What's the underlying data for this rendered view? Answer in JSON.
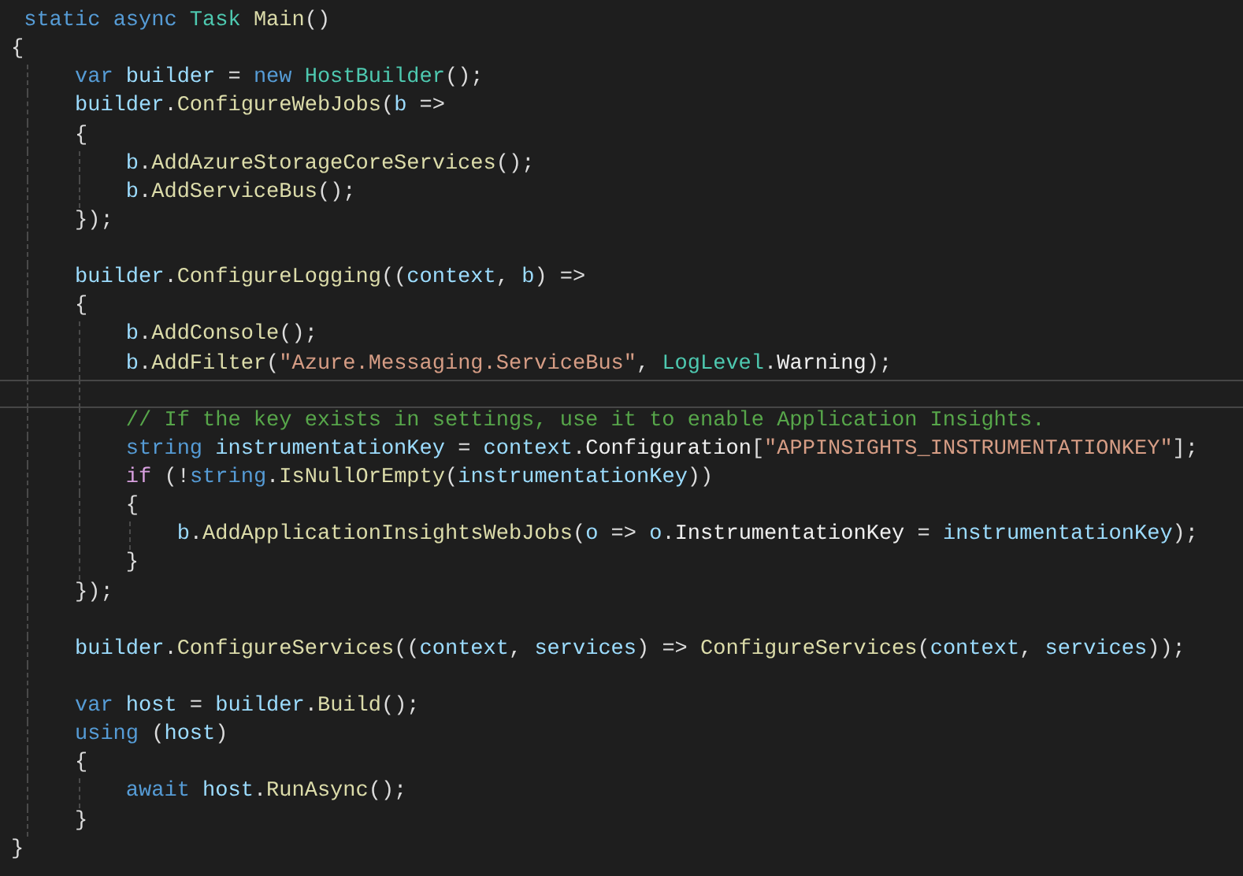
{
  "editor": {
    "lines": [
      {
        "kind": "code",
        "current": false,
        "tokens": [
          {
            "text": " static",
            "kind": "k"
          },
          {
            "text": " async",
            "kind": "k"
          },
          {
            "text": " Task",
            "kind": "y"
          },
          {
            "text": " Main",
            "kind": "m"
          },
          {
            "text": "()",
            "kind": "p"
          }
        ]
      },
      {
        "kind": "code",
        "current": false,
        "tokens": [
          {
            "text": "{",
            "kind": "p"
          }
        ]
      },
      {
        "kind": "code",
        "current": false,
        "tokens": [
          {
            "text": "     var",
            "kind": "k"
          },
          {
            "text": " builder",
            "kind": "v"
          },
          {
            "text": " = ",
            "kind": "p"
          },
          {
            "text": "new",
            "kind": "k"
          },
          {
            "text": " HostBuilder",
            "kind": "y"
          },
          {
            "text": "();",
            "kind": "p"
          }
        ]
      },
      {
        "kind": "code",
        "current": false,
        "tokens": [
          {
            "text": "     builder",
            "kind": "v"
          },
          {
            "text": ".",
            "kind": "p"
          },
          {
            "text": "ConfigureWebJobs",
            "kind": "m"
          },
          {
            "text": "(",
            "kind": "p"
          },
          {
            "text": "b",
            "kind": "v"
          },
          {
            "text": " =>",
            "kind": "p"
          }
        ]
      },
      {
        "kind": "code",
        "current": false,
        "tokens": [
          {
            "text": "     {",
            "kind": "p"
          }
        ]
      },
      {
        "kind": "code",
        "current": false,
        "tokens": [
          {
            "text": "         b",
            "kind": "v"
          },
          {
            "text": ".",
            "kind": "p"
          },
          {
            "text": "AddAzureStorageCoreServices",
            "kind": "m"
          },
          {
            "text": "();",
            "kind": "p"
          }
        ]
      },
      {
        "kind": "code",
        "current": false,
        "tokens": [
          {
            "text": "         b",
            "kind": "v"
          },
          {
            "text": ".",
            "kind": "p"
          },
          {
            "text": "AddServiceBus",
            "kind": "m"
          },
          {
            "text": "();",
            "kind": "p"
          }
        ]
      },
      {
        "kind": "code",
        "current": false,
        "tokens": [
          {
            "text": "     });",
            "kind": "p"
          }
        ]
      },
      {
        "kind": "blank",
        "current": false
      },
      {
        "kind": "code",
        "current": false,
        "tokens": [
          {
            "text": "     builder",
            "kind": "v"
          },
          {
            "text": ".",
            "kind": "p"
          },
          {
            "text": "ConfigureLogging",
            "kind": "m"
          },
          {
            "text": "((",
            "kind": "p"
          },
          {
            "text": "context",
            "kind": "v"
          },
          {
            "text": ", ",
            "kind": "p"
          },
          {
            "text": "b",
            "kind": "v"
          },
          {
            "text": ") =>",
            "kind": "p"
          }
        ]
      },
      {
        "kind": "code",
        "current": false,
        "tokens": [
          {
            "text": "     {",
            "kind": "p"
          }
        ]
      },
      {
        "kind": "code",
        "current": false,
        "tokens": [
          {
            "text": "         b",
            "kind": "v"
          },
          {
            "text": ".",
            "kind": "p"
          },
          {
            "text": "AddConsole",
            "kind": "m"
          },
          {
            "text": "();",
            "kind": "p"
          }
        ]
      },
      {
        "kind": "code",
        "current": false,
        "tokens": [
          {
            "text": "         b",
            "kind": "v"
          },
          {
            "text": ".",
            "kind": "p"
          },
          {
            "text": "AddFilter",
            "kind": "m"
          },
          {
            "text": "(",
            "kind": "p"
          },
          {
            "text": "\"Azure.Messaging.ServiceBus\"",
            "kind": "s"
          },
          {
            "text": ", ",
            "kind": "p"
          },
          {
            "text": "LogLevel",
            "kind": "y"
          },
          {
            "text": ".",
            "kind": "p"
          },
          {
            "text": "Warning",
            "kind": "w"
          },
          {
            "text": ");",
            "kind": "p"
          }
        ]
      },
      {
        "kind": "blank",
        "current": true
      },
      {
        "kind": "code",
        "current": false,
        "tokens": [
          {
            "text": "         // If the key exists in settings, use it to enable Application Insights.",
            "kind": "c"
          }
        ]
      },
      {
        "kind": "code",
        "current": false,
        "tokens": [
          {
            "text": "         string",
            "kind": "k"
          },
          {
            "text": " instrumentationKey",
            "kind": "v"
          },
          {
            "text": " = ",
            "kind": "p"
          },
          {
            "text": "context",
            "kind": "v"
          },
          {
            "text": ".",
            "kind": "p"
          },
          {
            "text": "Configuration",
            "kind": "w"
          },
          {
            "text": "[",
            "kind": "p"
          },
          {
            "text": "\"APPINSIGHTS_INSTRUMENTATIONKEY\"",
            "kind": "s"
          },
          {
            "text": "];",
            "kind": "p"
          }
        ]
      },
      {
        "kind": "code",
        "current": false,
        "tokens": [
          {
            "text": "         if",
            "kind": "f"
          },
          {
            "text": " (!",
            "kind": "p"
          },
          {
            "text": "string",
            "kind": "k"
          },
          {
            "text": ".",
            "kind": "p"
          },
          {
            "text": "IsNullOrEmpty",
            "kind": "m"
          },
          {
            "text": "(",
            "kind": "p"
          },
          {
            "text": "instrumentationKey",
            "kind": "v"
          },
          {
            "text": "))",
            "kind": "p"
          }
        ]
      },
      {
        "kind": "code",
        "current": false,
        "tokens": [
          {
            "text": "         {",
            "kind": "p"
          }
        ]
      },
      {
        "kind": "code",
        "current": false,
        "tokens": [
          {
            "text": "             b",
            "kind": "v"
          },
          {
            "text": ".",
            "kind": "p"
          },
          {
            "text": "AddApplicationInsightsWebJobs",
            "kind": "m"
          },
          {
            "text": "(",
            "kind": "p"
          },
          {
            "text": "o",
            "kind": "v"
          },
          {
            "text": " => ",
            "kind": "p"
          },
          {
            "text": "o",
            "kind": "v"
          },
          {
            "text": ".",
            "kind": "p"
          },
          {
            "text": "InstrumentationKey",
            "kind": "w"
          },
          {
            "text": " = ",
            "kind": "p"
          },
          {
            "text": "instrumentationKey",
            "kind": "v"
          },
          {
            "text": ");",
            "kind": "p"
          }
        ]
      },
      {
        "kind": "code",
        "current": false,
        "tokens": [
          {
            "text": "         }",
            "kind": "p"
          }
        ]
      },
      {
        "kind": "code",
        "current": false,
        "tokens": [
          {
            "text": "     });",
            "kind": "p"
          }
        ]
      },
      {
        "kind": "blank",
        "current": false
      },
      {
        "kind": "code",
        "current": false,
        "tokens": [
          {
            "text": "     builder",
            "kind": "v"
          },
          {
            "text": ".",
            "kind": "p"
          },
          {
            "text": "ConfigureServices",
            "kind": "m"
          },
          {
            "text": "((",
            "kind": "p"
          },
          {
            "text": "context",
            "kind": "v"
          },
          {
            "text": ", ",
            "kind": "p"
          },
          {
            "text": "services",
            "kind": "v"
          },
          {
            "text": ") => ",
            "kind": "p"
          },
          {
            "text": "ConfigureServices",
            "kind": "m"
          },
          {
            "text": "(",
            "kind": "p"
          },
          {
            "text": "context",
            "kind": "v"
          },
          {
            "text": ", ",
            "kind": "p"
          },
          {
            "text": "services",
            "kind": "v"
          },
          {
            "text": "));",
            "kind": "p"
          }
        ]
      },
      {
        "kind": "blank",
        "current": false
      },
      {
        "kind": "code",
        "current": false,
        "tokens": [
          {
            "text": "     var",
            "kind": "k"
          },
          {
            "text": " host",
            "kind": "v"
          },
          {
            "text": " = ",
            "kind": "p"
          },
          {
            "text": "builder",
            "kind": "v"
          },
          {
            "text": ".",
            "kind": "p"
          },
          {
            "text": "Build",
            "kind": "m"
          },
          {
            "text": "();",
            "kind": "p"
          }
        ]
      },
      {
        "kind": "code",
        "current": false,
        "tokens": [
          {
            "text": "     using",
            "kind": "k"
          },
          {
            "text": " (",
            "kind": "p"
          },
          {
            "text": "host",
            "kind": "v"
          },
          {
            "text": ")",
            "kind": "p"
          }
        ]
      },
      {
        "kind": "code",
        "current": false,
        "tokens": [
          {
            "text": "     {",
            "kind": "p"
          }
        ]
      },
      {
        "kind": "code",
        "current": false,
        "tokens": [
          {
            "text": "         await",
            "kind": "k"
          },
          {
            "text": " host",
            "kind": "v"
          },
          {
            "text": ".",
            "kind": "p"
          },
          {
            "text": "RunAsync",
            "kind": "m"
          },
          {
            "text": "();",
            "kind": "p"
          }
        ]
      },
      {
        "kind": "code",
        "current": false,
        "tokens": [
          {
            "text": "     }",
            "kind": "p"
          }
        ]
      },
      {
        "kind": "code",
        "current": false,
        "tokens": [
          {
            "text": "}",
            "kind": "p"
          }
        ]
      }
    ]
  }
}
